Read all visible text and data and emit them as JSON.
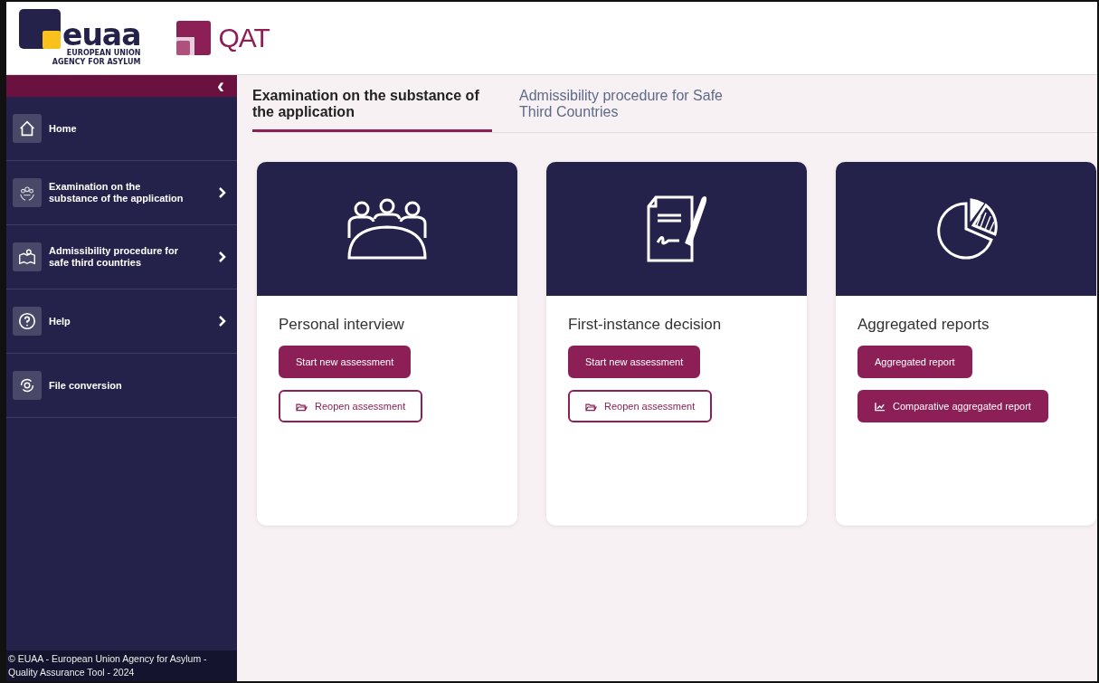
{
  "header": {
    "logo_word": "euaa",
    "logo_line_1": "EUROPEAN UNION",
    "logo_line_2": "AGENCY FOR ASYLUM",
    "app_name": "QAT"
  },
  "sidebar": {
    "collapse_icon": "‹",
    "items": [
      {
        "label": "Home",
        "kind": "home",
        "expandable": false
      },
      {
        "label": "Examination on the substance of the application",
        "kind": "people",
        "expandable": true
      },
      {
        "label": "Admissibility procedure for safe third countries",
        "kind": "map",
        "expandable": true
      },
      {
        "label": "Help",
        "kind": "help",
        "expandable": true
      },
      {
        "label": "File conversion",
        "kind": "convert",
        "expandable": false
      }
    ],
    "footer": "© EUAA - European Union Agency for Asylum - Quality Assurance Tool - 2024"
  },
  "tabs": [
    {
      "label": "Examination on the substance of the application",
      "selected": true
    },
    {
      "label": "Admissibility procedure for Safe Third Countries",
      "selected": false
    }
  ],
  "cards": [
    {
      "kind": "interview",
      "title": "Personal interview",
      "buttons": [
        {
          "label": "Start new assessment",
          "kind": "solid"
        },
        {
          "label": "Reopen assessment",
          "kind": "folder"
        }
      ]
    },
    {
      "kind": "decision",
      "title": "First-instance decision",
      "buttons": [
        {
          "label": "Start new assessment",
          "kind": "solid"
        },
        {
          "label": "Reopen assessment",
          "kind": "folder"
        }
      ]
    },
    {
      "kind": "reports",
      "title": "Aggregated reports",
      "buttons": [
        {
          "label": "Aggregated report",
          "kind": "solid"
        },
        {
          "label": "Comparative aggregated report",
          "kind": "chart"
        }
      ]
    }
  ]
}
